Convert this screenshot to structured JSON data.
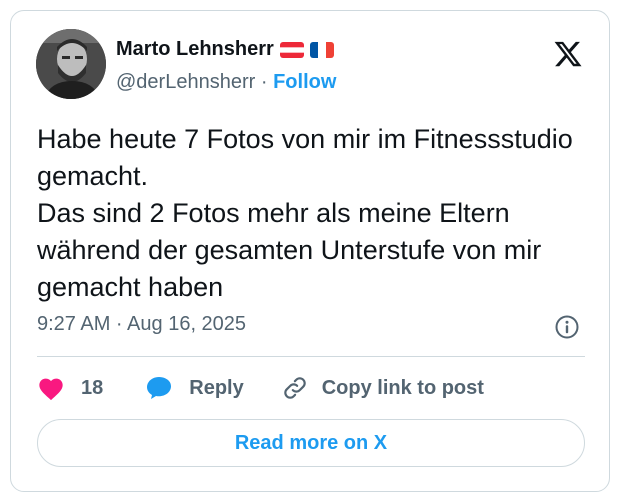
{
  "author": {
    "name": "Marto Lehnsherr",
    "handle": "@derLehnsherr",
    "separator": "·",
    "follow_label": "Follow",
    "flags": [
      "flag-austria",
      "flag-france"
    ]
  },
  "tweet": {
    "text": "Habe heute 7 Fotos von mir im Fitnessstudio gemacht.\nDas sind 2 Fotos mehr als meine Eltern während der gesamten Unterstufe von mir gemacht haben",
    "timestamp": "9:27 AM · Aug 16, 2025"
  },
  "actions": {
    "likes_count": "18",
    "reply_label": "Reply",
    "copy_link_label": "Copy link to post"
  },
  "footer": {
    "read_more_label": "Read more on X"
  },
  "colors": {
    "accent": "#1d9bf0",
    "like": "#f91880",
    "secondary_text": "#536471",
    "border": "#cfd9de"
  },
  "icons": [
    "x-logo-icon",
    "info-icon",
    "heart-icon",
    "reply-bubble-icon",
    "link-icon"
  ]
}
